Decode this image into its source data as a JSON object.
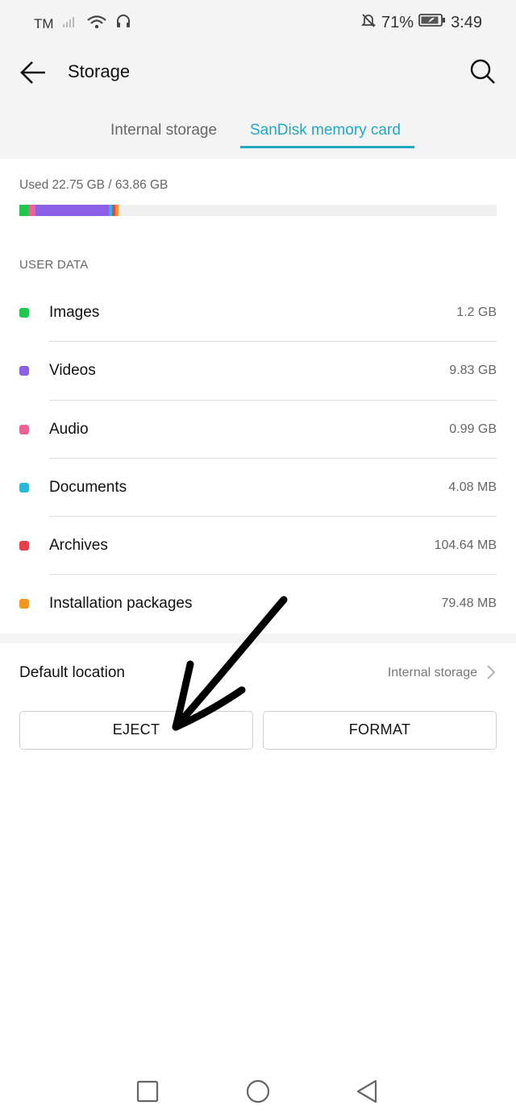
{
  "status_bar": {
    "carrier": "TM",
    "battery_percent": "71%",
    "time": "3:49",
    "icons": [
      "signal-icon",
      "wifi-icon",
      "headset-icon",
      "mute-icon",
      "battery-icon"
    ]
  },
  "toolbar": {
    "title": "Storage",
    "back_icon": "back-arrow-icon",
    "search_icon": "search-icon"
  },
  "tabs": [
    {
      "label": "Internal storage",
      "active": false
    },
    {
      "label": "SanDisk memory card",
      "active": true
    }
  ],
  "accent_color": "#1fa9c4",
  "storage": {
    "used_text": "Used 22.75 GB / 63.86 GB",
    "segments": [
      {
        "name": "Images",
        "color": "#1ec94a",
        "value_gb": 1.2
      },
      {
        "name": "Audio",
        "color": "#ef5f9a",
        "value_gb": 0.99
      },
      {
        "name": "Videos",
        "color": "#8d5ee6",
        "value_gb": 9.83
      },
      {
        "name": "Documents",
        "color": "#26b9dd",
        "value_gb": 0.004
      },
      {
        "name": "Archives",
        "color": "#e8404a",
        "value_gb": 0.105
      },
      {
        "name": "Installation packages",
        "color": "#f7941d",
        "value_gb": 0.079
      }
    ]
  },
  "user_data": {
    "header": "USER DATA",
    "items": [
      {
        "label": "Images",
        "value": "1.2 GB",
        "color": "#1ec94a"
      },
      {
        "label": "Videos",
        "value": "9.83 GB",
        "color": "#8d5ee6"
      },
      {
        "label": "Audio",
        "value": "0.99 GB",
        "color": "#ef5f9a"
      },
      {
        "label": "Documents",
        "value": "4.08 MB",
        "color": "#26b9dd"
      },
      {
        "label": "Archives",
        "value": "104.64 MB",
        "color": "#e8404a"
      },
      {
        "label": "Installation packages",
        "value": "79.48 MB",
        "color": "#f7941d"
      }
    ]
  },
  "default_location": {
    "label": "Default location",
    "value": "Internal storage"
  },
  "buttons": {
    "eject": "EJECT",
    "format": "FORMAT"
  },
  "nav_bar": {
    "icons": [
      "recent-apps-icon",
      "home-icon",
      "back-icon"
    ]
  }
}
